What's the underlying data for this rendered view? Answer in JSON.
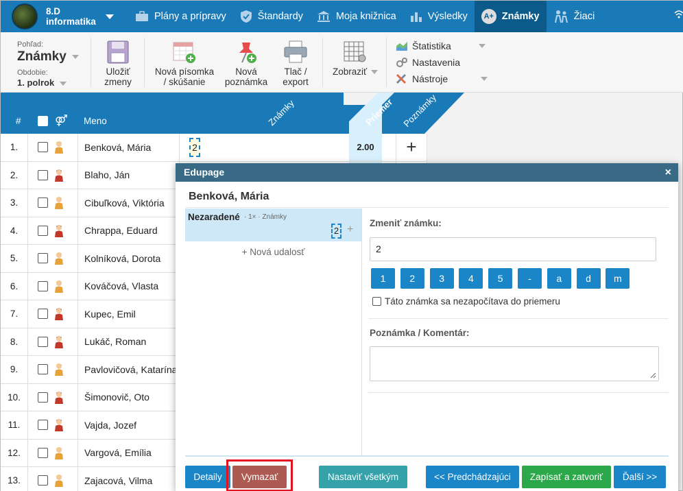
{
  "topnav": {
    "class_name_line1": "8.D",
    "class_name_line2": "informatika",
    "items": [
      {
        "label": "Plány a prípravy",
        "icon": "briefcase-icon"
      },
      {
        "label": "Štandardy",
        "icon": "shield-check-icon"
      },
      {
        "label": "Moja knižnica",
        "icon": "library-icon"
      },
      {
        "label": "Výsledky",
        "icon": "bar-chart-icon"
      },
      {
        "label": "Známky",
        "icon": "grade-badge-icon",
        "badge": "A+"
      },
      {
        "label": "Žiaci",
        "icon": "students-icon"
      }
    ]
  },
  "toolbar": {
    "view_label": "Pohľad:",
    "view_value": "Známky",
    "period_label": "Obdobie:",
    "period_value": "1. polrok",
    "save_line1": "Uložiť",
    "save_line2": "zmeny",
    "new_test_line1": "Nová písomka",
    "new_test_line2": "/ skúšanie",
    "new_note_line1": "Nová",
    "new_note_line2": "poznámka",
    "print_line1": "Tlač /",
    "print_line2": "export",
    "display": "Zobraziť",
    "statistics": "Štatistika",
    "settings": "Nastavenia",
    "tools": "Nástroje"
  },
  "table": {
    "col_num": "#",
    "col_name": "Meno",
    "col_grades": "Známky",
    "col_avg": "Priemer",
    "col_notes": "Poznámky",
    "rows": [
      {
        "n": "1.",
        "name": "Benková, Mária",
        "gender": "f",
        "grade": "2",
        "avg": "2.00"
      },
      {
        "n": "2.",
        "name": "Blaho, Ján",
        "gender": "m"
      },
      {
        "n": "3.",
        "name": "Cibuľková, Viktória",
        "gender": "f"
      },
      {
        "n": "4.",
        "name": "Chrappa, Eduard",
        "gender": "m"
      },
      {
        "n": "5.",
        "name": "Kolníková, Dorota",
        "gender": "f"
      },
      {
        "n": "6.",
        "name": "Kováčová, Vlasta",
        "gender": "f"
      },
      {
        "n": "7.",
        "name": "Kupec, Emil",
        "gender": "m"
      },
      {
        "n": "8.",
        "name": "Lukáč, Roman",
        "gender": "m"
      },
      {
        "n": "9.",
        "name": "Pavlovičová, Katarína",
        "gender": "f"
      },
      {
        "n": "10.",
        "name": "Šimonovič, Oto",
        "gender": "m"
      },
      {
        "n": "11.",
        "name": "Vajda, Jozef",
        "gender": "m"
      },
      {
        "n": "12.",
        "name": "Vargová, Emília",
        "gender": "f"
      },
      {
        "n": "13.",
        "name": "Zajacová, Vilma",
        "gender": "f"
      }
    ]
  },
  "modal": {
    "header": "Edupage",
    "close": "×",
    "student": "Benková, Mária",
    "event_title": "Nezaradené",
    "event_sub": "· 1× · Známky",
    "event_grade": "2",
    "event_add": "+",
    "new_event": "+ Nová udalosť",
    "change_grade_label": "Zmeniť známku:",
    "grade_value": "2",
    "grade_buttons": [
      "1",
      "2",
      "3",
      "4",
      "5",
      "-",
      "a",
      "d",
      "m"
    ],
    "exclude_avg": "Táto známka sa nezapočítava do priemeru",
    "comment_label": "Poznámka / Komentár:",
    "comment_value": ""
  },
  "footer": {
    "details": "Detaily",
    "delete": "Vymazať",
    "set_all": "Nastaviť všetkým",
    "prev": "<< Predchádzajúci",
    "save_close": "Zapísať a zatvoriť",
    "next": "Ďalší >>"
  },
  "colors": {
    "nav_blue": "#1a7ab7",
    "header_dark": "#0c5a8a",
    "btn_blue": "#1a86c8",
    "delete_red": "#ad5b52",
    "teal": "#35a2a9",
    "green": "#2aa84a",
    "highlight": "#e3141f"
  }
}
